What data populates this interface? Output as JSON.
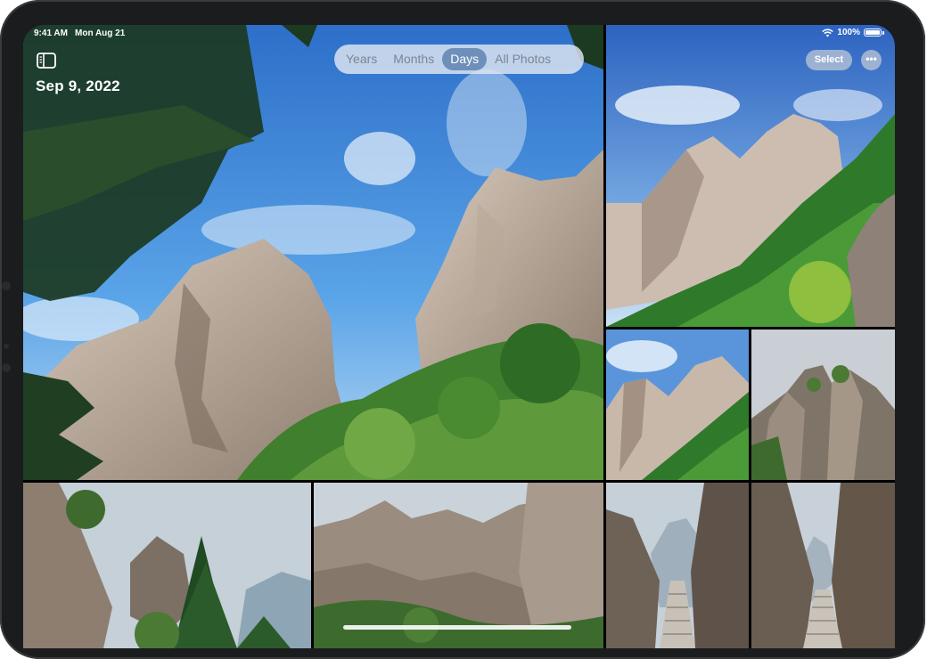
{
  "status_bar": {
    "time": "9:41 AM",
    "date": "Mon Aug 21",
    "battery": "100%",
    "wifi_icon": "wifi-icon",
    "battery_icon": "battery-icon"
  },
  "toolbar": {
    "segments": [
      {
        "label": "Years",
        "active": false
      },
      {
        "label": "Months",
        "active": false
      },
      {
        "label": "Days",
        "active": true
      },
      {
        "label": "All Photos",
        "active": false
      }
    ],
    "select_label": "Select",
    "more_label": "•••",
    "sidebar_icon": "sidebar-toggle-icon"
  },
  "header": {
    "date_title": "Sep 9, 2022"
  },
  "photos": [
    {
      "name": "hero-mountain-peaks"
    },
    {
      "name": "green-slope-peaks"
    },
    {
      "name": "small-peak-blue-sky"
    },
    {
      "name": "rock-formation-cloudy"
    },
    {
      "name": "pine-cliff-cloudy"
    },
    {
      "name": "rocky-valley"
    },
    {
      "name": "stone-stairs-1"
    },
    {
      "name": "stone-stairs-2"
    }
  ],
  "colors": {
    "segment_active": "#6d8fb9",
    "bezel": "#1b1c1e"
  }
}
